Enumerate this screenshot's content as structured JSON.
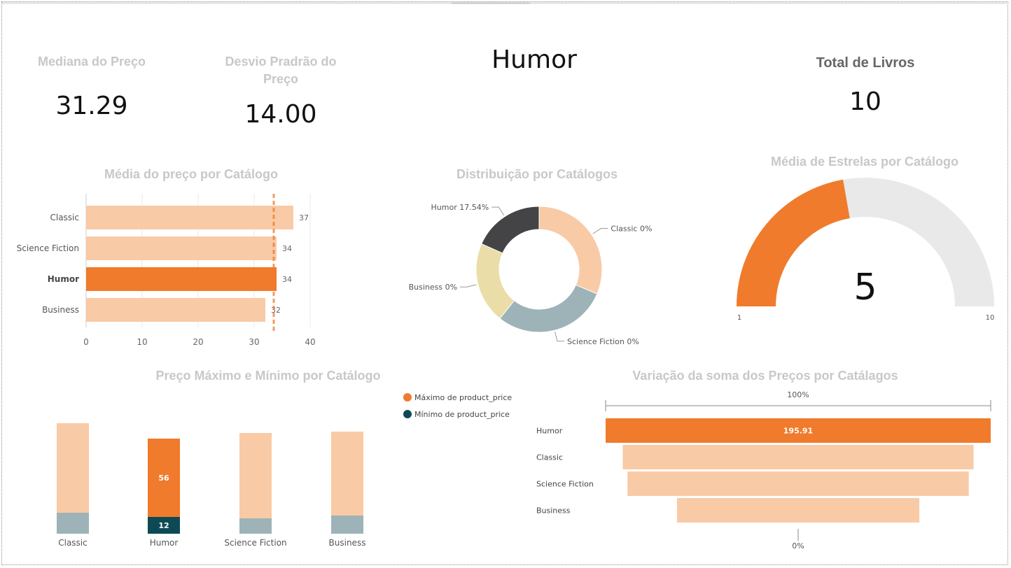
{
  "kpis": {
    "median": {
      "label": "Mediana do Preço",
      "value": "31.29"
    },
    "stddev": {
      "label": "Desvio Pradrão do Preço",
      "value": "14.00"
    },
    "selected_catalog": "Humor",
    "total_books": {
      "label": "Total de Livros",
      "value": "10"
    }
  },
  "colors": {
    "accent": "#f07b2c",
    "light": "#f9caa6",
    "dark_teal": "#0e4a55",
    "grey_teal": "#9db3b8",
    "donut_dark": "#444446",
    "donut_beige": "#ebdda7",
    "gauge_bg": "#e9e9e9"
  },
  "chart_data": [
    {
      "id": "avg_price",
      "type": "bar",
      "title": "Média do preço por  Catálogo",
      "categories": [
        "Classic",
        "Science Fiction",
        "Humor",
        "Business"
      ],
      "values": [
        37,
        34,
        34,
        32
      ],
      "highlight": "Humor",
      "xlim": [
        0,
        40
      ],
      "xticks": [
        0,
        10,
        20,
        30,
        40
      ],
      "reference_line": 33.5
    },
    {
      "id": "distribution",
      "type": "pie",
      "title": "Distribuição por Catálogos",
      "slices": [
        {
          "label": "Classic 0%",
          "value": 30
        },
        {
          "label": "Science Fiction 0%",
          "value": 28
        },
        {
          "label": "Business 0%",
          "value": 20
        },
        {
          "label": "Humor 17.54%",
          "value": 17.54
        }
      ]
    },
    {
      "id": "avg_stars",
      "type": "gauge",
      "title": "Média de Estrelas por Catálogo",
      "min": 1,
      "max": 10,
      "value": 5,
      "min_label": "1",
      "max_label": "10",
      "value_label": "5"
    },
    {
      "id": "max_min",
      "type": "bar",
      "title": "Preço Máximo e Mínimo por Catálogo",
      "categories": [
        "Classic",
        "Humor",
        "Science Fiction",
        "Business"
      ],
      "series": [
        {
          "name": "Máximo de product_price",
          "values": [
            64,
            56,
            61,
            60
          ]
        },
        {
          "name": "Mínimo de product_price",
          "values": [
            15,
            12,
            11,
            13
          ]
        }
      ],
      "data_labels": {
        "Humor": [
          "56",
          "12"
        ]
      },
      "highlight": "Humor",
      "legend_position": "right"
    },
    {
      "id": "funnel",
      "type": "bar",
      "title": "Variação da soma dos Preços por Catálagos",
      "categories": [
        "Humor",
        "Classic",
        "Science Fiction",
        "Business"
      ],
      "values": [
        195.91,
        178.5,
        173.6,
        123.3
      ],
      "top_label": "100%",
      "bottom_label": "0%",
      "bar_label": "195.91",
      "highlight": "Humor"
    }
  ]
}
